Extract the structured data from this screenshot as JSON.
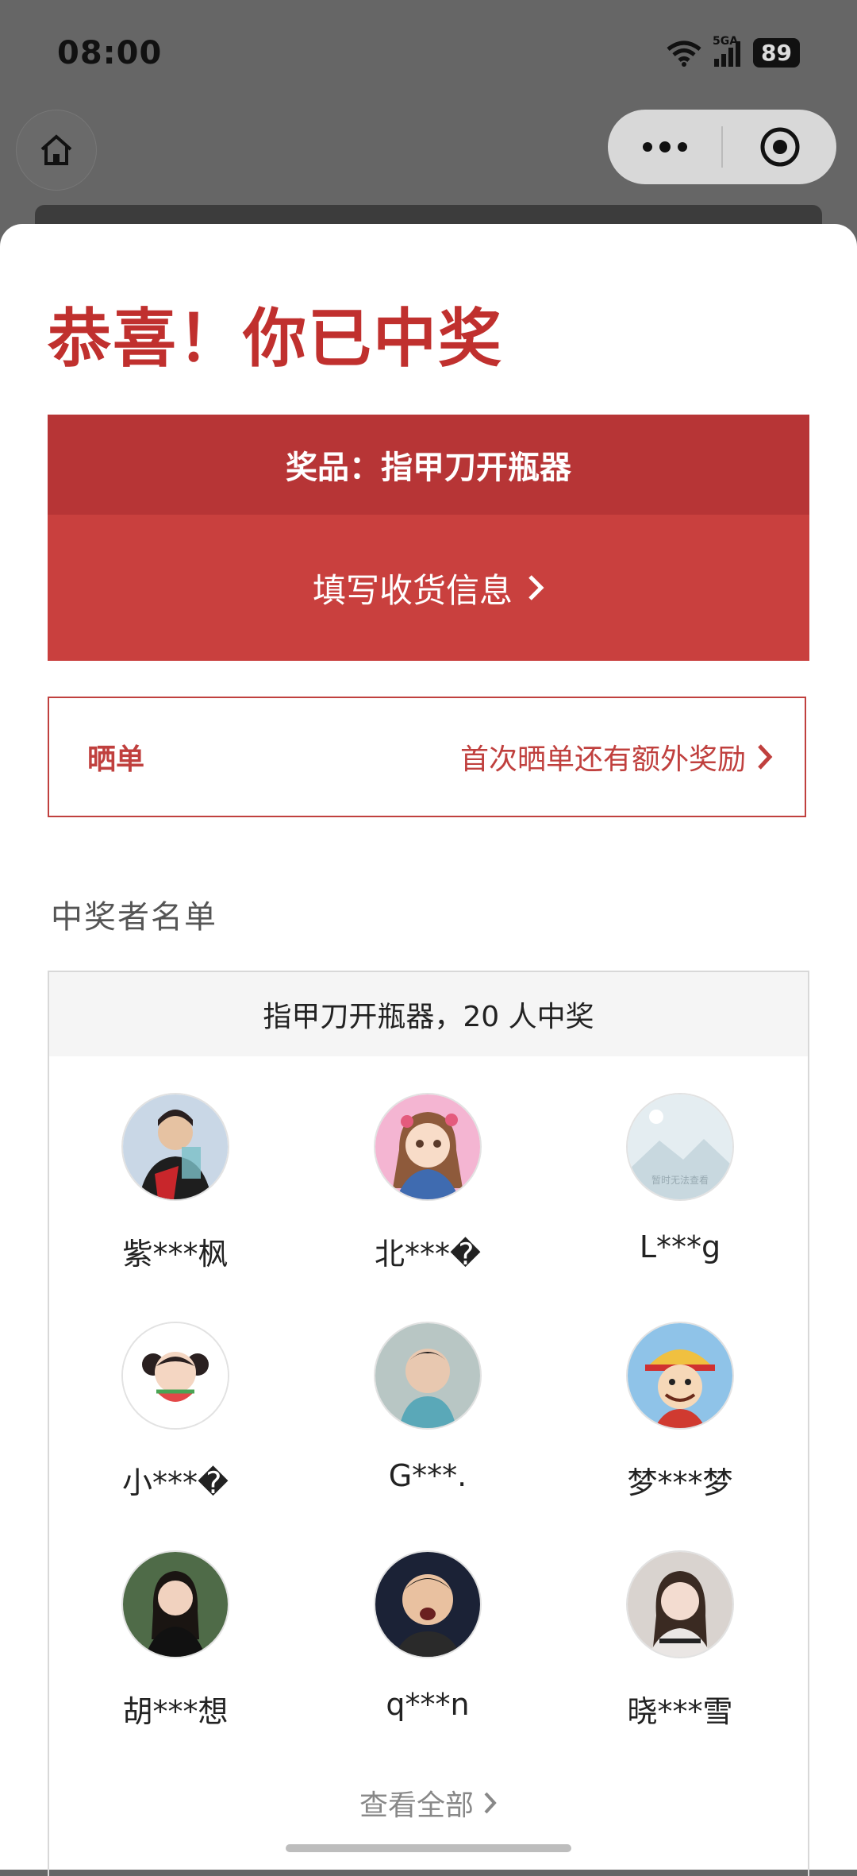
{
  "status_bar": {
    "time": "08:00",
    "network": "5GA",
    "battery": "89"
  },
  "nav": {
    "home_icon": "home-icon",
    "more_icon": "more-dots-icon",
    "close_icon": "target-close-icon"
  },
  "sheet": {
    "title": "恭喜！你已中奖",
    "prize_label": "奖品：指甲刀开瓶器",
    "fill_address_label": "填写收货信息",
    "share": {
      "label": "晒单",
      "tip": "首次晒单还有额外奖励"
    },
    "winners_section_title": "中奖者名单",
    "winners_header": "指甲刀开瓶器，20 人中奖",
    "winners": [
      {
        "name": "紫***枫",
        "avatar": "photo"
      },
      {
        "name": "北***�",
        "avatar": "cartoon-girl"
      },
      {
        "name": "L***g",
        "avatar": "placeholder"
      },
      {
        "name": "小***�",
        "avatar": "watermelon-girl"
      },
      {
        "name": "G***.",
        "avatar": "child-photo"
      },
      {
        "name": "梦***梦",
        "avatar": "cartoon-pirate"
      },
      {
        "name": "胡***想",
        "avatar": "photo"
      },
      {
        "name": "q***n",
        "avatar": "photo"
      },
      {
        "name": "晓***雪",
        "avatar": "photo"
      }
    ],
    "placeholder_text": "暂时无法查看",
    "view_all_label": "查看全部"
  },
  "colors": {
    "accent": "#c0302e",
    "prize_head": "#b73536",
    "prize_fill": "#c9403e"
  }
}
